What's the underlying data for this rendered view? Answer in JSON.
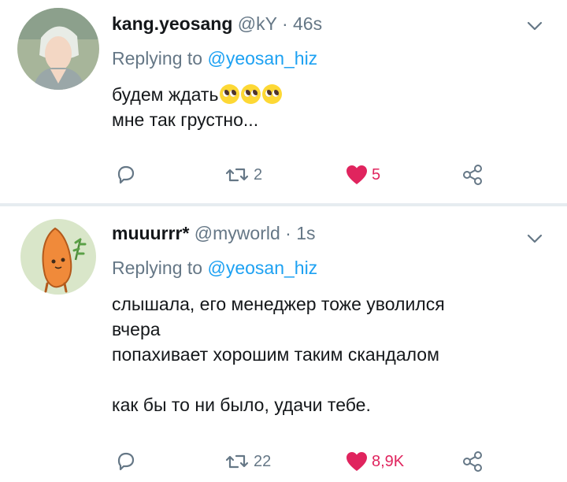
{
  "tweets": [
    {
      "display_name": "kang.yeosang",
      "handle": "@kY",
      "separator": "·",
      "time": "46s",
      "replying_prefix": "Replying to",
      "replying_to": "@yeosan_hiz",
      "lines": [
        "будем ждать",
        "мне так грустно..."
      ],
      "emoji": [
        "pleading-face",
        "pleading-face",
        "pleading-face"
      ],
      "reply_count": "",
      "retweet_count": "2",
      "like_count": "5",
      "liked": true
    },
    {
      "display_name": "muuurrr*",
      "handle": "@myworld",
      "separator": "·",
      "time": "1s",
      "replying_prefix": "Replying to",
      "replying_to": "@yeosan_hiz",
      "lines": [
        "слышала, его менеджер тоже уволился",
        "вчера",
        "попахивает хорошим таким скандалом",
        "",
        "как бы то ни было, удачи тебе."
      ],
      "reply_count": "",
      "retweet_count": "22",
      "like_count": "8,9K",
      "liked": true
    }
  ],
  "icons": {
    "reply": "reply-icon",
    "retweet": "retweet-icon",
    "like": "heart-icon",
    "share": "share-icon",
    "menu": "chevron-down-icon"
  },
  "colors": {
    "text": "#14171a",
    "secondary": "#657786",
    "link": "#1da1f2",
    "like": "#e0245e",
    "divider": "#e6ecf0"
  }
}
